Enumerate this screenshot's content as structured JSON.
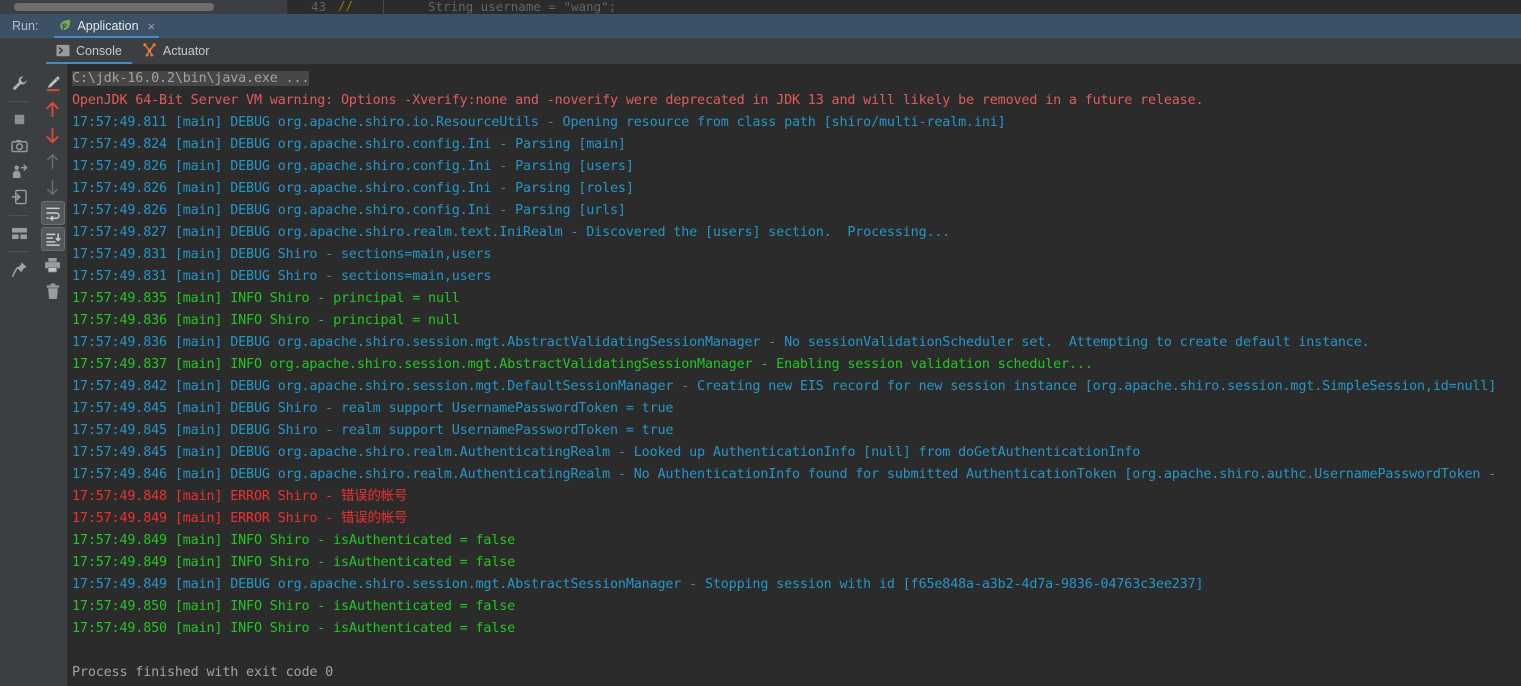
{
  "editor_sliver": {
    "line_number": "43",
    "fold_marker": "//",
    "code_text": "String username = \"wang\";"
  },
  "run_header": {
    "run_label": "Run:",
    "tab_label": "Application",
    "tab_close_glyph": "×"
  },
  "subtabs": [
    {
      "label": "Console",
      "icon": "console-icon",
      "active": true
    },
    {
      "label": "Actuator",
      "icon": "actuator-icon",
      "active": false
    }
  ],
  "toolbar_left": [
    {
      "name": "settings-wrench-icon",
      "kind": "icon"
    },
    {
      "name": "separator",
      "kind": "sep"
    },
    {
      "name": "stop-icon",
      "kind": "icon"
    },
    {
      "name": "camera-snapshot-icon",
      "kind": "icon"
    },
    {
      "name": "thread-dump-icon",
      "kind": "icon"
    },
    {
      "name": "export-icon",
      "kind": "icon"
    },
    {
      "name": "separator",
      "kind": "sep"
    },
    {
      "name": "layout-icon",
      "kind": "icon"
    },
    {
      "name": "separator",
      "kind": "sep"
    },
    {
      "name": "pin-tab-icon",
      "kind": "icon"
    }
  ],
  "toolbar_mid": [
    {
      "name": "highlight-marker-icon",
      "kind": "icon"
    },
    {
      "name": "up-red-arrow-icon",
      "kind": "icon"
    },
    {
      "name": "down-red-arrow-icon",
      "kind": "icon"
    },
    {
      "name": "up-gray-arrow-icon",
      "kind": "icon"
    },
    {
      "name": "down-gray-arrow-icon",
      "kind": "icon"
    },
    {
      "name": "soft-wrap-icon",
      "kind": "icon-pressed"
    },
    {
      "name": "scroll-to-end-icon",
      "kind": "icon-pressed"
    },
    {
      "name": "print-icon",
      "kind": "icon"
    },
    {
      "name": "trash-icon",
      "kind": "icon"
    }
  ],
  "colors": {
    "accent_blue": "#4a88c7",
    "tab_bar_blue": "#3c5166",
    "panel_gray": "#3c3f41",
    "console_bg": "#2b2b2b",
    "debug_cyan": "#2596c8",
    "info_green": "#23c723",
    "error_red": "#f03030",
    "warn_red": "#e05c5c",
    "system_gray": "#a2a2a2"
  },
  "console": {
    "lines": [
      {
        "type": "cmd",
        "text": "C:\\jdk-16.0.2\\bin\\java.exe ..."
      },
      {
        "type": "warn",
        "text": "OpenJDK 64-Bit Server VM warning: Options -Xverify:none and -noverify were deprecated in JDK 13 and will likely be removed in a future release."
      },
      {
        "type": "debug",
        "text": "17:57:49.811 [main] DEBUG org.apache.shiro.io.ResourceUtils - Opening resource from class path [shiro/multi-realm.ini]"
      },
      {
        "type": "debug",
        "text": "17:57:49.824 [main] DEBUG org.apache.shiro.config.Ini - Parsing [main]"
      },
      {
        "type": "debug",
        "text": "17:57:49.826 [main] DEBUG org.apache.shiro.config.Ini - Parsing [users]"
      },
      {
        "type": "debug",
        "text": "17:57:49.826 [main] DEBUG org.apache.shiro.config.Ini - Parsing [roles]"
      },
      {
        "type": "debug",
        "text": "17:57:49.826 [main] DEBUG org.apache.shiro.config.Ini - Parsing [urls]"
      },
      {
        "type": "debug",
        "text": "17:57:49.827 [main] DEBUG org.apache.shiro.realm.text.IniRealm - Discovered the [users] section.  Processing..."
      },
      {
        "type": "debug",
        "text": "17:57:49.831 [main] DEBUG Shiro - sections=main,users"
      },
      {
        "type": "debug",
        "text": "17:57:49.831 [main] DEBUG Shiro - sections=main,users"
      },
      {
        "type": "info",
        "text": "17:57:49.835 [main] INFO Shiro - principal = null"
      },
      {
        "type": "info",
        "text": "17:57:49.836 [main] INFO Shiro - principal = null"
      },
      {
        "type": "debug",
        "text": "17:57:49.836 [main] DEBUG org.apache.shiro.session.mgt.AbstractValidatingSessionManager - No sessionValidationScheduler set.  Attempting to create default instance."
      },
      {
        "type": "info",
        "text": "17:57:49.837 [main] INFO org.apache.shiro.session.mgt.AbstractValidatingSessionManager - Enabling session validation scheduler..."
      },
      {
        "type": "debug",
        "text": "17:57:49.842 [main] DEBUG org.apache.shiro.session.mgt.DefaultSessionManager - Creating new EIS record for new session instance [org.apache.shiro.session.mgt.SimpleSession,id=null]"
      },
      {
        "type": "debug",
        "text": "17:57:49.845 [main] DEBUG Shiro - realm support UsernamePasswordToken = true"
      },
      {
        "type": "debug",
        "text": "17:57:49.845 [main] DEBUG Shiro - realm support UsernamePasswordToken = true"
      },
      {
        "type": "debug",
        "text": "17:57:49.845 [main] DEBUG org.apache.shiro.realm.AuthenticatingRealm - Looked up AuthenticationInfo [null] from doGetAuthenticationInfo"
      },
      {
        "type": "debug",
        "text": "17:57:49.846 [main] DEBUG org.apache.shiro.realm.AuthenticatingRealm - No AuthenticationInfo found for submitted AuthenticationToken [org.apache.shiro.authc.UsernamePasswordToken -"
      },
      {
        "type": "error",
        "text": "17:57:49.848 [main] ERROR Shiro - 错误的帐号"
      },
      {
        "type": "error",
        "text": "17:57:49.849 [main] ERROR Shiro - 错误的帐号"
      },
      {
        "type": "info",
        "text": "17:57:49.849 [main] INFO Shiro - isAuthenticated = false"
      },
      {
        "type": "info",
        "text": "17:57:49.849 [main] INFO Shiro - isAuthenticated = false"
      },
      {
        "type": "debug",
        "text": "17:57:49.849 [main] DEBUG org.apache.shiro.session.mgt.AbstractSessionManager - Stopping session with id [f65e848a-a3b2-4d7a-9836-04763c3ee237]"
      },
      {
        "type": "info",
        "text": "17:57:49.850 [main] INFO Shiro - isAuthenticated = false"
      },
      {
        "type": "info",
        "text": "17:57:49.850 [main] INFO Shiro - isAuthenticated = false"
      },
      {
        "type": "blank",
        "text": " "
      },
      {
        "type": "sys",
        "text": "Process finished with exit code 0"
      }
    ]
  }
}
